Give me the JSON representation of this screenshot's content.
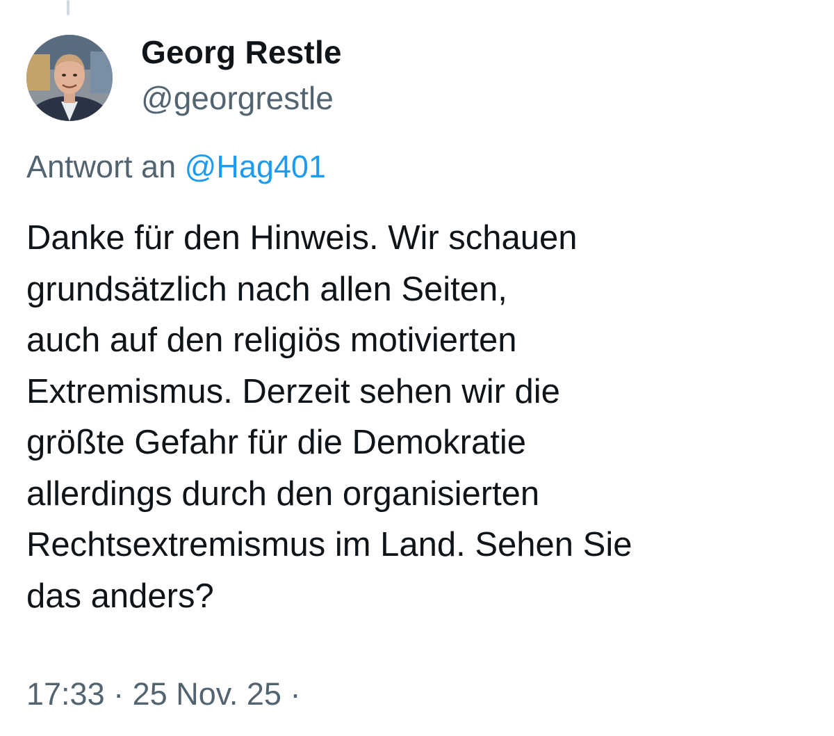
{
  "author": {
    "display_name": "Georg Restle",
    "handle": "@georgrestle",
    "avatar": "profile-photo"
  },
  "reply_context": {
    "prefix": "Antwort an",
    "mention": "@Hag401"
  },
  "tweet": {
    "text_lines": [
      "Danke für den Hinweis. Wir schauen",
      "grundsätzlich nach allen Seiten,",
      "auch auf den religiös motivierten",
      "Extremismus. Derzeit sehen wir die",
      "größte Gefahr für die Demokratie",
      "allerdings durch den organisierten",
      "Rechtsextremismus im Land. Sehen Sie",
      "das anders?"
    ],
    "time": "17:33",
    "separator": "·",
    "date": "25 Nov. 25",
    "trailing_separator": "·"
  },
  "colors": {
    "text_primary": "#0f1419",
    "text_secondary": "#536471",
    "mention_blue": "#1d9bf0",
    "thread_line": "#cfd9de"
  }
}
